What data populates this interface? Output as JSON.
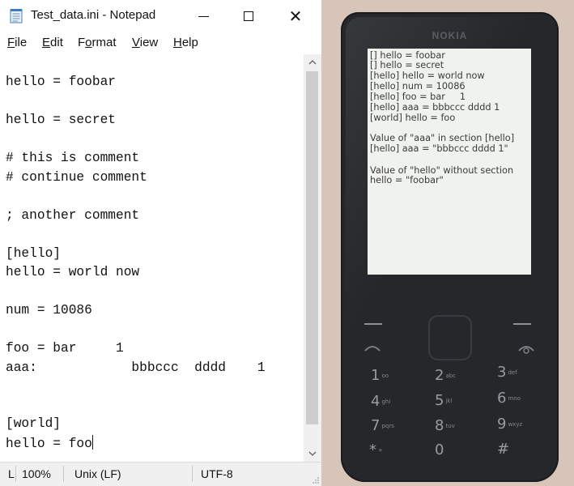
{
  "window": {
    "title": "Test_data.ini - Notepad"
  },
  "menu": [
    {
      "label": "File",
      "ul": "F",
      "rest": "ile"
    },
    {
      "label": "Edit",
      "ul": "E",
      "rest": "dit"
    },
    {
      "label": "Format",
      "pre": "F",
      "ul": "o",
      "rest": "rmat"
    },
    {
      "label": "View",
      "ul": "V",
      "rest": "iew"
    },
    {
      "label": "Help",
      "ul": "H",
      "rest": "elp"
    }
  ],
  "editor": {
    "lines": [
      "hello = foobar",
      "hello = secret",
      "# this is comment",
      "# continue comment",
      "; another comment",
      "[hello]",
      "hello = world now",
      "num = 10086",
      "foo = bar     1",
      "aaa:            bbbccc  dddd    1",
      "[world]",
      "hello = foo"
    ]
  },
  "status": {
    "position": "L",
    "zoom": "100%",
    "line_ending": "Unix (LF)",
    "encoding": "UTF-8"
  },
  "phone": {
    "brand": "NOKIA",
    "screen_lines": [
      "[] hello = foobar",
      "[] hello = secret",
      "[hello] hello = world now",
      "[hello] num = 10086",
      "[hello] foo = bar     1",
      "[hello] aaa = bbbccc dddd 1",
      "[world] hello = foo",
      "Value of \"aaa\" in section [hello]",
      "[hello] aaa = \"bbbccc dddd 1\"",
      "Value of \"hello\" without section",
      "hello = \"foobar\""
    ],
    "keys": [
      {
        "digit": "1",
        "letters": "oo"
      },
      {
        "digit": "2",
        "letters": "abc"
      },
      {
        "digit": "3",
        "letters": "def"
      },
      {
        "digit": "4",
        "letters": "ghi"
      },
      {
        "digit": "5",
        "letters": "jkl"
      },
      {
        "digit": "6",
        "letters": "mno"
      },
      {
        "digit": "7",
        "letters": "pqrs"
      },
      {
        "digit": "8",
        "letters": "tuv"
      },
      {
        "digit": "9",
        "letters": "wxyz"
      },
      {
        "digit": "*",
        "letters": "+"
      },
      {
        "digit": "0",
        "letters": ""
      },
      {
        "digit": "#",
        "letters": ""
      }
    ]
  }
}
